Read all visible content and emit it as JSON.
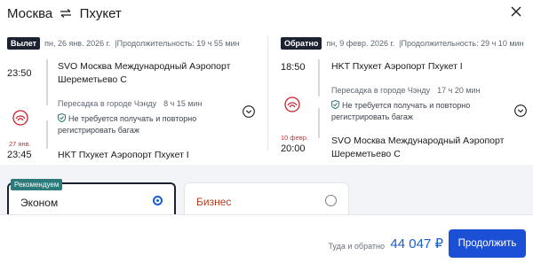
{
  "header": {
    "from_city": "Москва",
    "swap_icon": "swap-arrows",
    "to_city": "Пхукет",
    "close_icon": "close"
  },
  "outbound": {
    "badge": "Вылет",
    "date": "пн, 26 янв. 2026 г.",
    "duration": "Продолжительность: 19 ч 55 мин",
    "dep_time": "23:50",
    "dep_airport": "SVO Москва Международный Аэропорт Шереметьево C",
    "transfer_text": "Пересадка в городе Чэнду",
    "transfer_duration": "8 ч 15 мин",
    "baggage_text": "Не требуется получать и повторно регистрировать багаж",
    "arrival_date": "27 янв.",
    "arr_time": "23:45",
    "arr_airport": "HKT Пхукет Аэропорт Пхукет I"
  },
  "return": {
    "badge": "Обратно",
    "date": "пн, 9 февр. 2026 г.",
    "duration": "Продолжительность: 29 ч 10 мин",
    "dep_time": "18:50",
    "dep_airport": "HKT Пхукет Аэропорт Пхукет I",
    "transfer_text": "Пересадка в городе Чэнду",
    "transfer_duration": "17 ч 20 мин",
    "baggage_text": "Не требуется получать и повторно регистрировать багаж",
    "arrival_date": "10 февр.",
    "arr_time": "20:00",
    "arr_airport": "SVO Москва Международный Аэропорт Шереметьево C"
  },
  "fares": {
    "recommended_badge": "Рекомендуем",
    "economy": "Эконом",
    "economy_selected": true,
    "business": "Бизнес",
    "business_selected": false
  },
  "footer": {
    "total_label": "Туда и обратно",
    "total_price": "44 047 ₽",
    "book_button": "Продолжить"
  },
  "colors": {
    "accent": "#1a4fd6",
    "price": "#1a5fc8",
    "business_label": "#b43c1e",
    "recommended_badge": "#2c7a7b",
    "next_day": "#d2332f"
  }
}
